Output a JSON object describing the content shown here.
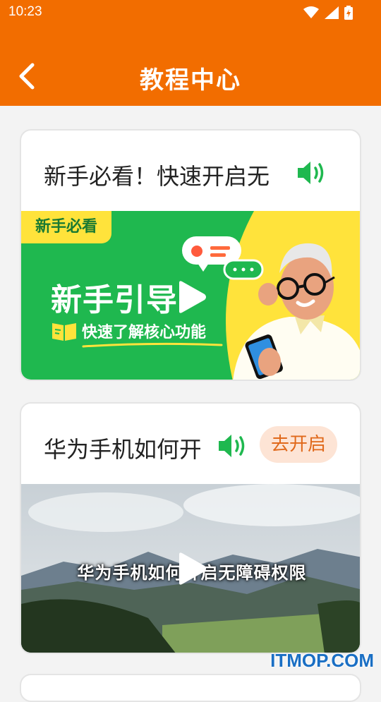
{
  "status_bar": {
    "time": "10:23"
  },
  "header": {
    "title": "教程中心"
  },
  "cards": [
    {
      "title": "新手必看！快速开启无",
      "banner": {
        "tag": "新手必看",
        "heading": "新手引导",
        "subtitle": "快速了解核心功能"
      }
    },
    {
      "title": "华为手机如何开",
      "enable_button": "去开启",
      "video": {
        "caption": "华为手机如何开启无障碍权限"
      }
    }
  ],
  "watermark": "ITMOP.COM",
  "colors": {
    "brand_orange": "#f26d00",
    "green": "#1fb84f",
    "yellow": "#ffe33b"
  }
}
